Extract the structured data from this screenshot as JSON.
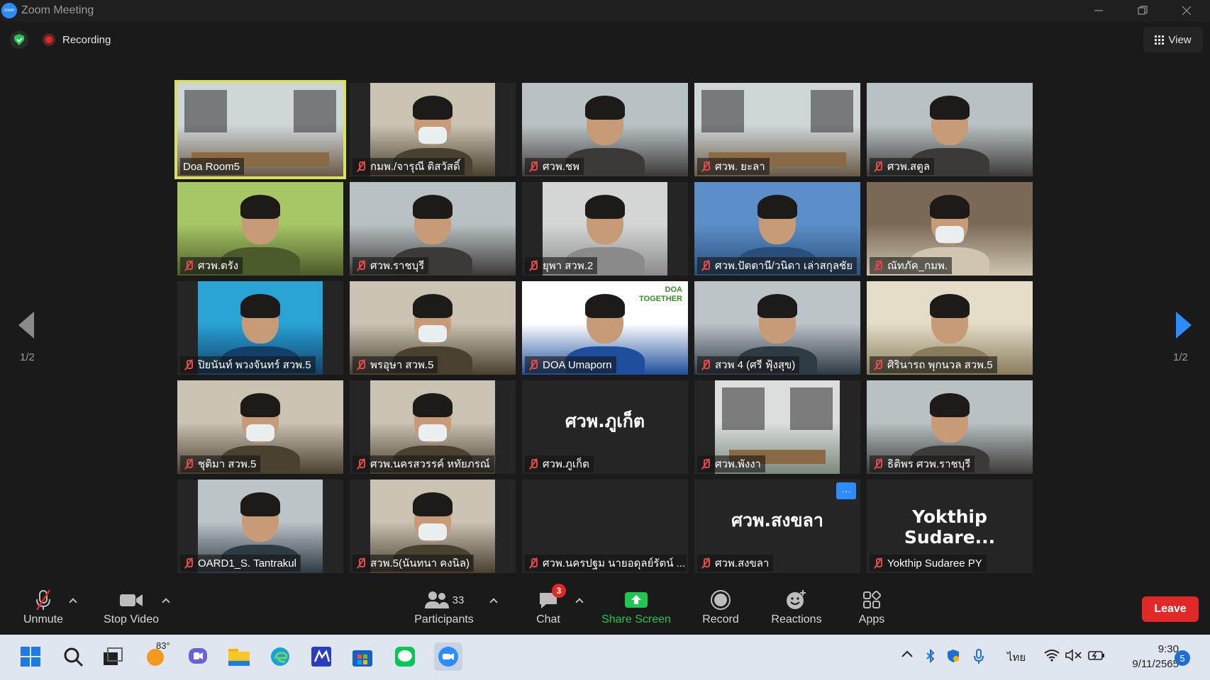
{
  "window": {
    "title": "Zoom Meeting",
    "logo_text": "zoom"
  },
  "topbar": {
    "recording_label": "Recording",
    "view_label": "View"
  },
  "pager": {
    "left_page": "1/2",
    "right_page": "1/2"
  },
  "participants": [
    {
      "name": "Doa Room5",
      "muted": false,
      "active": true,
      "video": "room"
    },
    {
      "name": "กมพ./จารุณี ติสวัสดิ์",
      "muted": true,
      "video": "woman-mask"
    },
    {
      "name": "ศวพ.ชพ",
      "muted": true,
      "video": "woman"
    },
    {
      "name": "ศวพ. ยะลา",
      "muted": true,
      "video": "room"
    },
    {
      "name": "ศวพ.สตูล",
      "muted": true,
      "video": "woman"
    },
    {
      "name": "ศวพ.ตรัง",
      "muted": true,
      "video": "man-green"
    },
    {
      "name": "ศวพ.ราชบุรี",
      "muted": true,
      "video": "woman"
    },
    {
      "name": "ยุพา สวพ.2",
      "muted": true,
      "video": "office-small"
    },
    {
      "name": "ศวพ.ปัตตานี/วนิดา เล่าสกุลชัย",
      "muted": true,
      "video": "woman-sky"
    },
    {
      "name": "ณัทภัค_กมพ.",
      "muted": true,
      "video": "man-mask"
    },
    {
      "name": "ปิยนันท์ พวงจันทร์ สวพ.5",
      "muted": true,
      "video": "man-blue"
    },
    {
      "name": "พรอุษา สวพ.5",
      "muted": true,
      "video": "woman-mask"
    },
    {
      "name": "DOA Umaporn",
      "muted": true,
      "video": "doa"
    },
    {
      "name": "สวพ 4 (ศรี ฟุ้งสุข)",
      "muted": true,
      "video": "man"
    },
    {
      "name": "ศิรินารถ พุกนวล สวพ.5",
      "muted": true,
      "video": "woman-shield"
    },
    {
      "name": "ชุติมา สวพ.5",
      "muted": true,
      "video": "woman-mask"
    },
    {
      "name": "ศวพ.นครสวรรค์ หทัยภรณ์",
      "muted": true,
      "video": "woman-mask"
    },
    {
      "name": "ศวพ.ภูเก็ต",
      "muted": true,
      "video": "none",
      "big": "ศวพ.ภูเก็ต"
    },
    {
      "name": "ศวพ.พังงา",
      "muted": true,
      "video": "office"
    },
    {
      "name": "ธิติพร ศวพ.ราชบุรี",
      "muted": true,
      "video": "woman"
    },
    {
      "name": "OARD1_S. Tantrakul",
      "muted": true,
      "video": "man"
    },
    {
      "name": "สวพ.5(นันทนา คงนิล)",
      "muted": true,
      "video": "woman-mask"
    },
    {
      "name": "ศวพ.นครปฐม นายอดุลย์รัตน์ ...",
      "muted": true,
      "video": "none",
      "big": ""
    },
    {
      "name": "ศวพ.สงขลา",
      "muted": true,
      "video": "none",
      "big": "ศวพ.สงขลา",
      "more": "···"
    },
    {
      "name": "Yokthip Sudaree PY",
      "muted": true,
      "video": "none",
      "big": "Yokthip  Sudare..."
    }
  ],
  "toolbar": {
    "unmute": "Unmute",
    "stop_video": "Stop Video",
    "participants": "Participants",
    "participant_count": "33",
    "chat": "Chat",
    "chat_badge": "3",
    "share_screen": "Share Screen",
    "record": "Record",
    "reactions": "Reactions",
    "apps": "Apps",
    "leave": "Leave"
  },
  "taskbar": {
    "weather_temp": "83°",
    "language": "ไทย",
    "time": "9:30",
    "date": "9/11/2565",
    "notifications": "5",
    "icons": [
      "windows-start-icon",
      "search-icon",
      "task-view-icon",
      "weather-icon",
      "teams-chat-icon",
      "file-explorer-icon",
      "edge-icon",
      "visual-studio-icon",
      "microsoft-store-icon",
      "line-app-icon",
      "zoom-app-icon"
    ]
  },
  "colors": {
    "accent_blue": "#2d8cff",
    "leave_red": "#e02828",
    "share_green": "#23c552",
    "active_speaker": "#d8e06a"
  }
}
